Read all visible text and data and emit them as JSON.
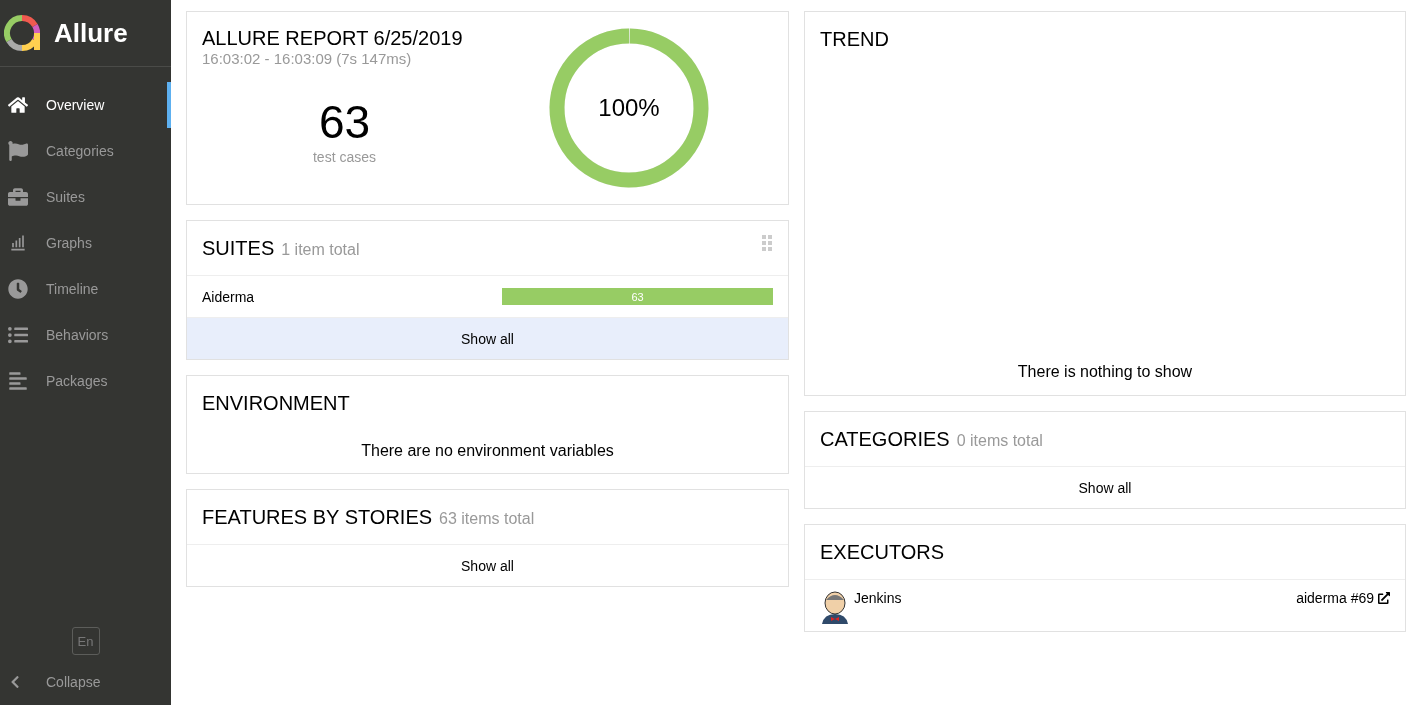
{
  "app": {
    "name": "Allure"
  },
  "sidebar": {
    "items": [
      {
        "label": "Overview",
        "selected": true
      },
      {
        "label": "Categories",
        "selected": false
      },
      {
        "label": "Suites",
        "selected": false
      },
      {
        "label": "Graphs",
        "selected": false
      },
      {
        "label": "Timeline",
        "selected": false
      },
      {
        "label": "Behaviors",
        "selected": false
      },
      {
        "label": "Packages",
        "selected": false
      }
    ],
    "language": "En",
    "collapse": "Collapse"
  },
  "summary": {
    "title": "ALLURE REPORT 6/25/2019",
    "time": "16:03:02 - 16:03:09 (7s 147ms)",
    "count": "63",
    "count_label": "test cases",
    "donut": {
      "level": 1,
      "label": "100%"
    }
  },
  "suites": {
    "title": "SUITES",
    "count": "1 item total",
    "rows": [
      {
        "name": "Aiderma",
        "bar_label": "63",
        "level": 1
      }
    ],
    "show_all": "Show all"
  },
  "environment": {
    "title": "ENVIRONMENT",
    "message": "There are no environment variables"
  },
  "features": {
    "title": "FEATURES BY STORIES",
    "count": "63 items total",
    "show_all": "Show all"
  },
  "trend": {
    "title": "TREND",
    "message": "There is nothing to show"
  },
  "categories": {
    "title": "CATEGORIES",
    "count": "0 items total",
    "show_all": "Show all"
  },
  "executors": {
    "title": "EXECUTORS",
    "rows": [
      {
        "name": "Jenkins",
        "build": "aiderma #69"
      }
    ]
  }
}
